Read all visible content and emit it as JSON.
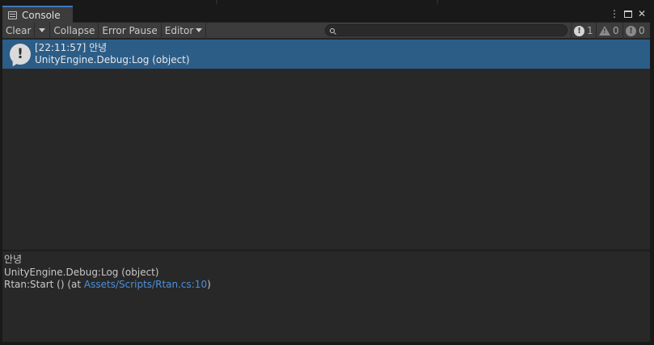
{
  "tab": {
    "title": "Console"
  },
  "window": {
    "menu_glyph": "⋮",
    "close_glyph": "✕"
  },
  "toolbar": {
    "clear_label": "Clear",
    "collapse_label": "Collapse",
    "error_pause_label": "Error Pause",
    "editor_label": "Editor",
    "search_placeholder": "",
    "log_count": "1",
    "warning_count": "0",
    "error_count": "0"
  },
  "log": {
    "entries": [
      {
        "time": "[22:11:57]",
        "message": "안녕",
        "source": "UnityEngine.Debug:Log (object)"
      }
    ]
  },
  "detail": {
    "message": "안녕",
    "line1": "UnityEngine.Debug:Log (object)",
    "line2_prefix": "Rtan:Start () (at ",
    "line2_link": "Assets/Scripts/Rtan.cs:10",
    "line2_suffix": ")"
  },
  "colors": {
    "selection": "#2c5d87",
    "link": "#4c8fd9",
    "tab_accent": "#3a79bb"
  }
}
